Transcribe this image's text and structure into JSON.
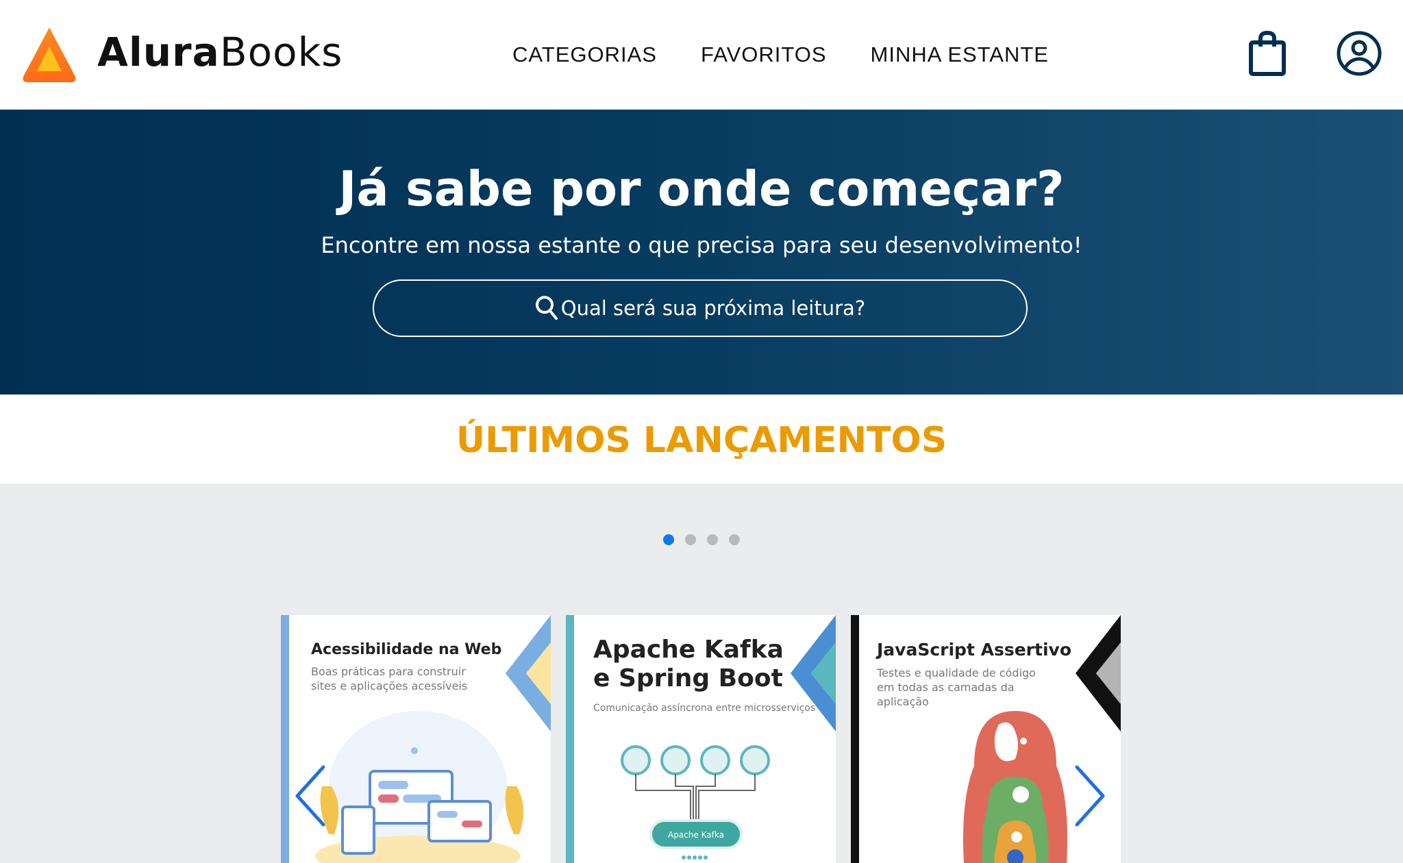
{
  "header": {
    "brand_primary": "Alura",
    "brand_secondary": "Books",
    "nav": [
      "CATEGORIAS",
      "FAVORITOS",
      "MINHA ESTANTE"
    ],
    "icons": [
      "shopping-bag-icon",
      "user-icon"
    ]
  },
  "hero": {
    "title": "Já sabe por onde começar?",
    "subtitle": "Encontre em nossa estante o que precisa para seu desenvolvimento!",
    "search_placeholder": "Qual será sua próxima leitura?"
  },
  "releases": {
    "title": "ÚLTIMOS LANÇAMENTOS",
    "dots_total": 4,
    "active_dot": 1,
    "books": [
      {
        "title": "Acessibilidade na Web",
        "subtitle": "Boas práticas para construir sites e aplicações acessíveis",
        "accent": "#7aaee0"
      },
      {
        "title": "Apache Kafka e Spring Boot",
        "title_line1": "Apache Kafka",
        "title_line2": "e Spring Boot",
        "subtitle": "Comunicação assíncrona entre microsserviços",
        "accent": "#5bb6be",
        "diagram_label": "Apache Kafka"
      },
      {
        "title": "JavaScript Assertivo",
        "subtitle_line1": "Testes e qualidade de código",
        "subtitle_line2": "em todas as camadas da aplicação",
        "accent": "#111111"
      }
    ]
  },
  "colors": {
    "hero_dark": "#002f52",
    "highlight": "#eb9b00",
    "dot_active": "#0a7ae8",
    "carousel_bg": "#ebecee"
  }
}
